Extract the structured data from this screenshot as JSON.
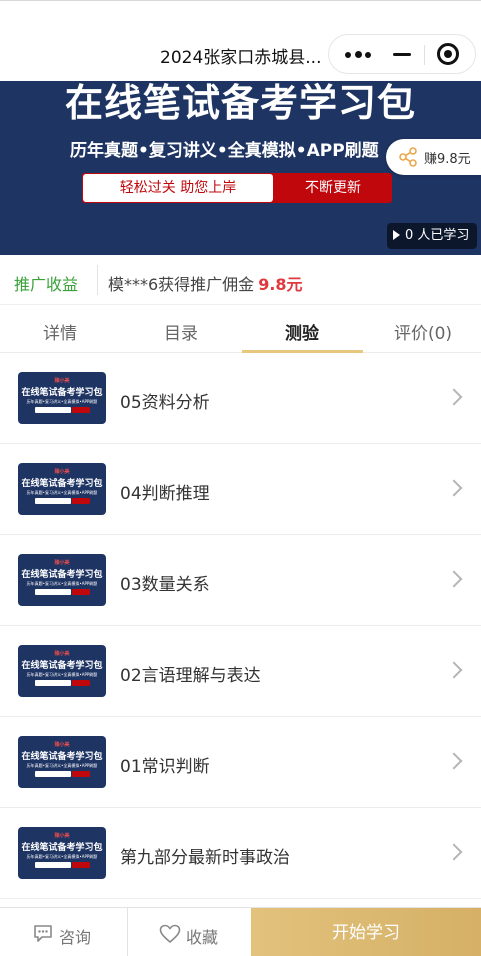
{
  "nav": {
    "title": "2024张家口赤城县..."
  },
  "banner": {
    "headline": "在线笔试备考学习包",
    "subtitle": "历年真题•复习讲义•全真模拟•APP刷题",
    "pill_left": "轻松过关  助您上岸",
    "pill_right": "不断更新",
    "share_label": "赚9.8元",
    "learners": "0 人已学习"
  },
  "promo": {
    "label": "推广收益",
    "text": "模***6获得推广佣金",
    "amount": "9.8元"
  },
  "tabs": [
    {
      "label": "详情",
      "active": false
    },
    {
      "label": "目录",
      "active": false
    },
    {
      "label": "测验",
      "active": true
    },
    {
      "label": "评价(0)",
      "active": false
    }
  ],
  "thumbnail": {
    "brand": "臻小美",
    "headline": "在线笔试备考学习包",
    "subtitle": "历年真题•复习讲义•全真模拟•APP刷题"
  },
  "items": [
    {
      "title": "05资料分析"
    },
    {
      "title": "04判断推理"
    },
    {
      "title": "03数量关系"
    },
    {
      "title": "02言语理解与表达"
    },
    {
      "title": "01常识判断"
    },
    {
      "title": "第九部分最新时事政治"
    }
  ],
  "bottom": {
    "consult": "咨询",
    "favorite": "收藏",
    "start": "开始学习"
  },
  "colors": {
    "accent_gold": "#d9b56c",
    "promo_green": "#39a33a",
    "amount_red": "#e0383e",
    "banner_navy": "#1e3463"
  }
}
